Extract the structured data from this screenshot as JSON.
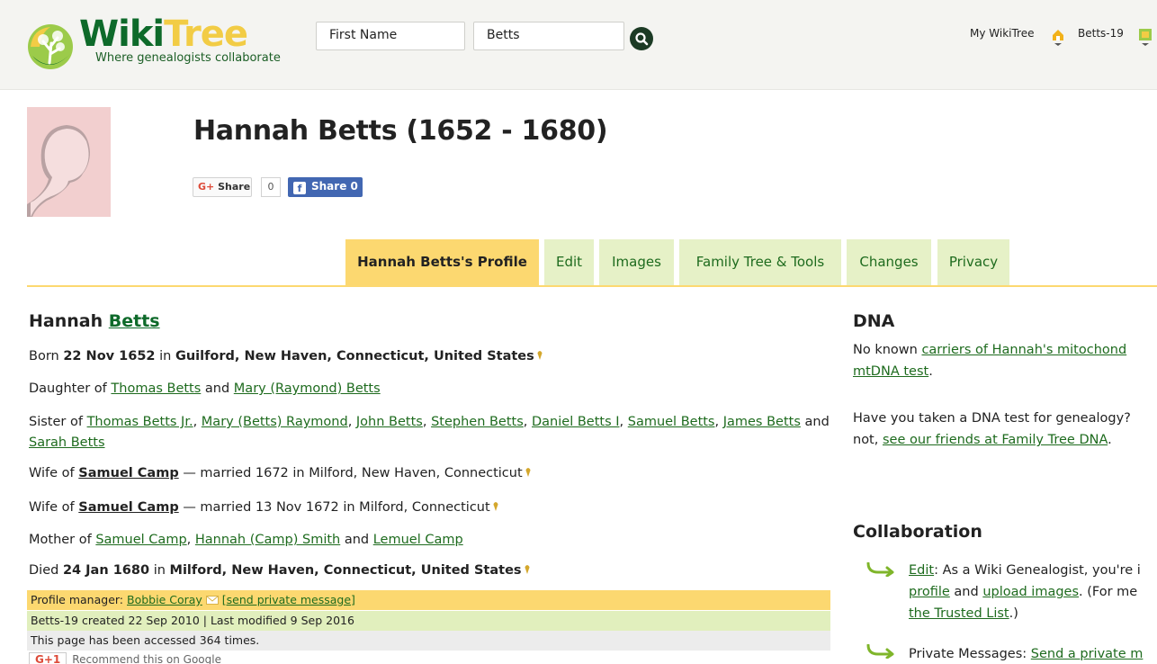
{
  "header": {
    "logo_wiki": "Wiki",
    "logo_tree": "Tree",
    "logo_tagline": "Where genealogists collaborate",
    "first_name_placeholder": "First Name",
    "last_name_value": "Betts",
    "my_wikitree": "My WikiTree",
    "user_id": "Betts-19"
  },
  "profile": {
    "title": "Hannah Betts (1652 - 1680)",
    "gplus_share": "Share",
    "gplus_count": "0",
    "fb_share": "Share 0"
  },
  "tabs": [
    {
      "label": "Hannah Betts's Profile",
      "active": true
    },
    {
      "label": "Edit",
      "active": false
    },
    {
      "label": "Images",
      "active": false
    },
    {
      "label": "Family Tree & Tools",
      "active": false
    },
    {
      "label": "Changes",
      "active": false
    },
    {
      "label": "Privacy",
      "active": false
    }
  ],
  "bio": {
    "first_name": "Hannah",
    "surname": "Betts",
    "born_prefix": "Born",
    "born_date": "22 Nov 1652",
    "in": "in",
    "born_place": "Guilford, New Haven, Connecticut, United States",
    "daughter_prefix": "Daughter of",
    "father": "Thomas Betts",
    "and": "and",
    "mother": "Mary (Raymond) Betts",
    "sister_prefix": "Sister of",
    "siblings": [
      "Thomas Betts Jr.",
      "Mary (Betts) Raymond",
      "John Betts",
      "Stephen Betts",
      "Daniel Betts I",
      "Samuel Betts",
      "James Betts",
      "Sarah Betts"
    ],
    "wife_prefix": "Wife of",
    "spouse": "Samuel Camp",
    "marriage1": "— married 1672 in Milford, New Haven, Connecticut",
    "marriage2": "— married 13 Nov 1672 in Milford, Connecticut",
    "mother_prefix": "Mother of",
    "children": [
      "Samuel Camp",
      "Hannah (Camp) Smith",
      "Lemuel Camp"
    ],
    "died_prefix": "Died",
    "died_date": "24 Jan 1680",
    "died_place": "Milford, New Haven, Connecticut, United States",
    "manager_label": "Profile manager:",
    "manager_name": "Bobbie Coray",
    "send_message": "[send private message]",
    "created": "Betts-19 created 22 Sep 2010 | Last modified 9 Sep 2016",
    "accessed": "This page has been accessed 364 times.",
    "recommend_gplus": "G+1",
    "recommend_text": "Recommend this on Google"
  },
  "dna": {
    "heading": "DNA",
    "line1_text": "No known",
    "line1_link": "carriers of Hannah's mitochond",
    "line2_link": "mtDNA test",
    "line2_end": ".",
    "line3": "Have you taken a DNA test for genealogy?",
    "line4_text": "not,",
    "line4_link": "see our friends at Family Tree DNA",
    "line4_end": "."
  },
  "collaboration": {
    "heading": "Collaboration",
    "edit_link": "Edit",
    "edit_text": ": As a Wiki Genealogist, you're i",
    "profile_link": "profile",
    "and": "and",
    "upload_link": "upload images",
    "more_text": ". (For me",
    "trusted_link": "the Trusted List",
    "trusted_end": ".)",
    "pm_text": "Private Messages:",
    "pm_link": "Send a private m"
  },
  "colors": {
    "header_bg": "#f4f4f1",
    "active_tab": "#fcd870",
    "tab_bg": "#e6f1c7",
    "link": "#1e6b1e",
    "facebook": "#4267b2"
  }
}
